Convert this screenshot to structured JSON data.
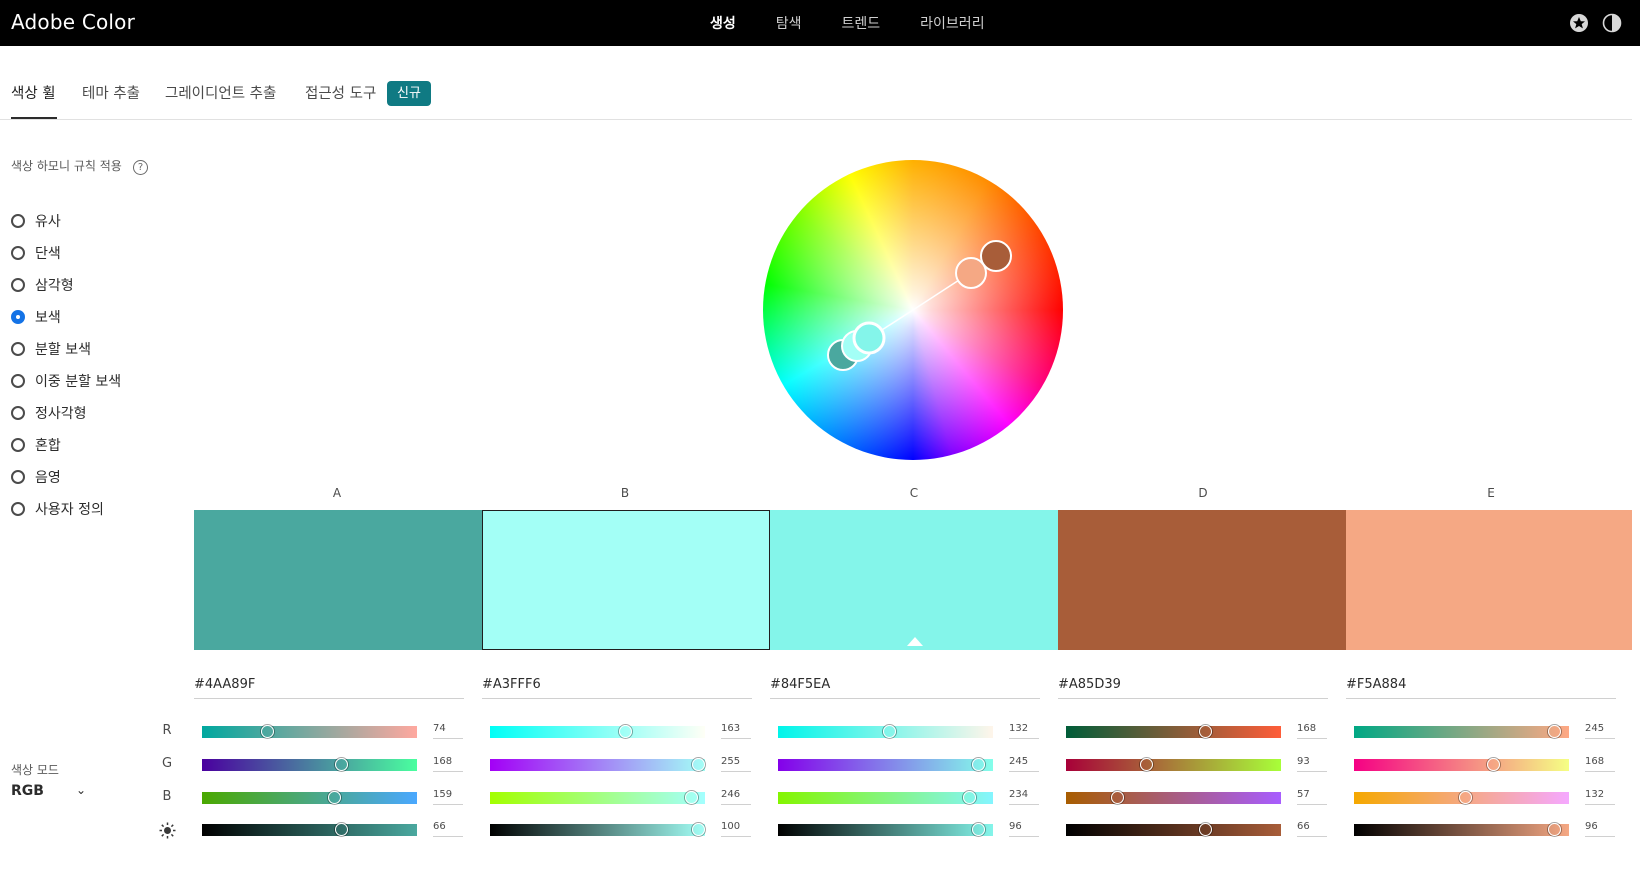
{
  "app": {
    "title": "Adobe Color"
  },
  "topnav": [
    {
      "label": "생성",
      "active": true
    },
    {
      "label": "탐색",
      "active": false
    },
    {
      "label": "트렌드",
      "active": false
    },
    {
      "label": "라이브러리",
      "active": false
    }
  ],
  "top_icons": [
    "star-icon",
    "contrast-icon"
  ],
  "tabs": [
    {
      "label": "색상 휠",
      "active": true
    },
    {
      "label": "테마 추출",
      "active": false
    },
    {
      "label": "그레이디언트 추출",
      "active": false
    },
    {
      "label": "접근성 도구",
      "active": false
    }
  ],
  "new_badge": "신규",
  "harmony": {
    "title": "색상 하모니 규칙 적용",
    "help": "?",
    "rules": [
      "유사",
      "단색",
      "삼각형",
      "보색",
      "분할 보색",
      "이중 분할 보색",
      "정사각형",
      "혼합",
      "음영",
      "사용자 정의"
    ],
    "selected": "보색"
  },
  "color_mode": {
    "label": "색상 모드",
    "value": "RGB"
  },
  "swatches": [
    {
      "label": "A",
      "hex": "#4AA89F",
      "color": "#4AA89F",
      "r": 74,
      "g": 168,
      "b": 159,
      "brightness": 66
    },
    {
      "label": "B",
      "hex": "#A3FFF6",
      "color": "#A3FFF6",
      "r": 163,
      "g": 255,
      "b": 246,
      "brightness": 100,
      "selected": true
    },
    {
      "label": "C",
      "hex": "#84F5EA",
      "color": "#84F5EA",
      "r": 132,
      "g": 245,
      "b": 234,
      "brightness": 96,
      "base": true
    },
    {
      "label": "D",
      "hex": "#A85D39",
      "color": "#A85D39",
      "r": 168,
      "g": 93,
      "b": 57,
      "brightness": 66
    },
    {
      "label": "E",
      "hex": "#F5A884",
      "color": "#F5A884",
      "r": 245,
      "g": 168,
      "b": 132,
      "brightness": 96
    }
  ],
  "channels": [
    "R",
    "G",
    "B"
  ],
  "brightness_icon": "brightness-icon"
}
